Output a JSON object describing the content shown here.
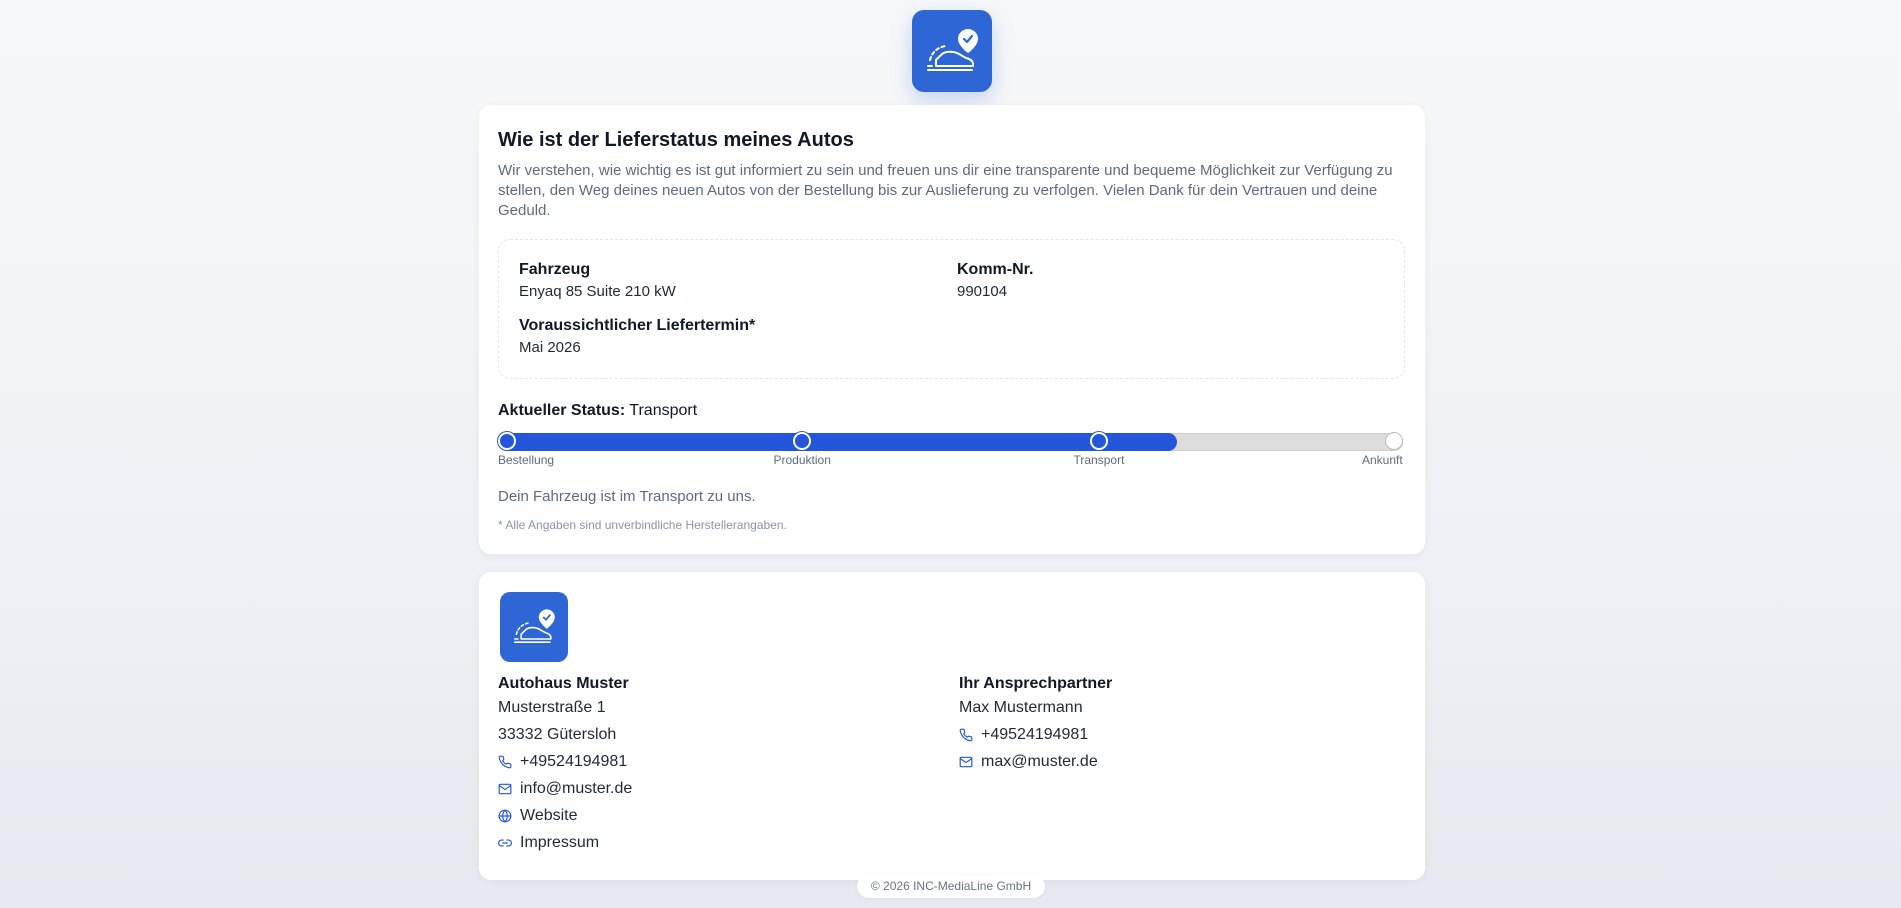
{
  "header": {
    "logo_icon": "car-delivery-check-icon"
  },
  "status_card": {
    "title": "Wie ist der Lieferstatus meines Autos",
    "intro": "Wir verstehen, wie wichtig es ist gut informiert zu sein und freuen uns dir eine transparente und bequeme Möglichkeit zur Verfügung zu stellen, den Weg deines neuen Autos von der Bestellung bis zur Auslieferung zu verfolgen. Vielen Dank für dein Vertrauen und deine Geduld.",
    "info": {
      "vehicle_label": "Fahrzeug",
      "vehicle_value": "Enyaq 85 Suite 210 kW",
      "comm_label": "Komm-Nr.",
      "comm_value": "990104",
      "delivery_label": "Voraussichtlicher Liefertermin*",
      "delivery_value": "Mai 2026"
    },
    "current_status_label": "Aktueller Status:",
    "current_status_value": "Transport",
    "progress": {
      "fraction": 0.75,
      "accent_color": "#2356d8",
      "steps": [
        {
          "label": "Bestellung",
          "done": true
        },
        {
          "label": "Produktion",
          "done": true
        },
        {
          "label": "Transport",
          "done": true
        },
        {
          "label": "Ankunft",
          "done": false
        }
      ]
    },
    "status_description": "Dein Fahrzeug ist im Transport zu uns.",
    "disclaimer": "* Alle Angaben sind unverbindliche Herstellerangaben."
  },
  "contact_card": {
    "logo_icon": "car-delivery-check-icon",
    "dealer": {
      "name": "Autohaus Muster",
      "street": "Musterstraße 1",
      "city": "33332 Gütersloh",
      "phone": "+49524194981",
      "email": "info@muster.de",
      "website": "Website",
      "imprint": "Impressum"
    },
    "contact_person": {
      "title": "Ihr Ansprechpartner",
      "name": "Max Mustermann",
      "phone": "+49524194981",
      "email": "max@muster.de"
    }
  },
  "footer": {
    "copyright": "© 2026 INC-MediaLine GmbH"
  }
}
